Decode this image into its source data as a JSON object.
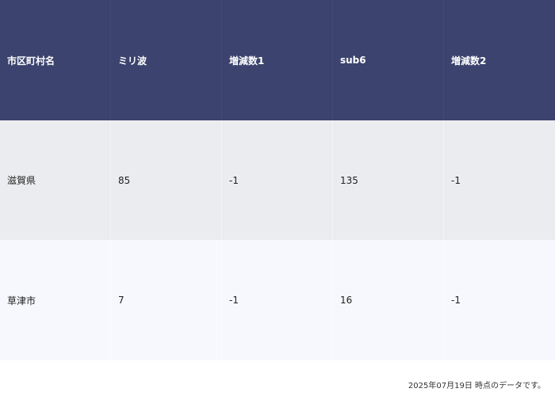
{
  "table": {
    "headers": [
      "市区町村名",
      "ミリ波",
      "増減数1",
      "sub6",
      "増減数2"
    ],
    "rows": [
      [
        "滋賀県",
        "85",
        "-1",
        "135",
        "-1"
      ],
      [
        "草津市",
        "7",
        "-1",
        "16",
        "-1"
      ]
    ]
  },
  "footnote": "2025年07月19日 時点のデータです。",
  "colors": {
    "header_bg": "#3b436e",
    "row1_bg": "#ebecef",
    "row2_bg": "#f7f8fd"
  }
}
